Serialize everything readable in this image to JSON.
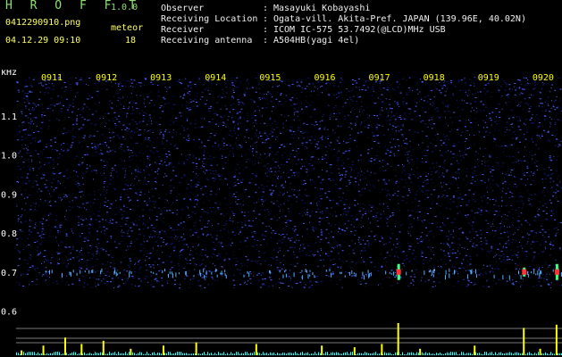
{
  "app": {
    "brand": "H R O F F T",
    "version": "1.0.0",
    "filename": "0412290910.png",
    "timestamp": "04.12.29 09:10",
    "meteor_label": "meteor",
    "meteor_count": "18"
  },
  "info": [
    {
      "label": "Observer",
      "value": "Masayuki Kobayashi"
    },
    {
      "label": "Receiving Location",
      "value": "Ogata-vill. Akita-Pref. JAPAN (139.96E, 40.02N)"
    },
    {
      "label": "Receiver",
      "value": "ICOM IC-575 53.7492(@LCD)MHz USB"
    },
    {
      "label": "Receiving antenna",
      "value": "A504HB(yagi 4el)"
    }
  ],
  "info_separator": ":",
  "colors": {
    "background": "#000000",
    "noise_dark": "#101870",
    "noise_bright": "#4c5cff",
    "time_label": "#ffff00",
    "axis_label": "#ffffff",
    "counter_bars": "#ffff00",
    "counter_noise": "#33ffff",
    "echo_red": "#ff3030",
    "echo_green": "#40ff80",
    "green_text": "#8fe070"
  },
  "chart_data": {
    "type": "heatmap",
    "title": "",
    "unit_label": "kHz",
    "time_ticks": [
      "0911",
      "0912",
      "0913",
      "0914",
      "0915",
      "0916",
      "0917",
      "0918",
      "0919",
      "0920"
    ],
    "freq_ticks": [
      1.1,
      1.0,
      0.9,
      0.8,
      0.7,
      0.6
    ],
    "freq_range_khz": [
      0.56,
      1.2
    ],
    "time_range_minutes": [
      0,
      10
    ],
    "meteor_echoes": [
      {
        "time_min": 7.0,
        "freq_khz": 0.7,
        "strength": "strong"
      },
      {
        "time_min": 9.3,
        "freq_khz": 0.7,
        "strength": "medium"
      },
      {
        "time_min": 9.9,
        "freq_khz": 0.7,
        "strength": "strong"
      }
    ],
    "meteor_count_bars": [
      {
        "time_min": 0.1,
        "height": 0.15
      },
      {
        "time_min": 0.5,
        "height": 0.3
      },
      {
        "time_min": 0.9,
        "height": 0.55
      },
      {
        "time_min": 1.2,
        "height": 0.35
      },
      {
        "time_min": 1.6,
        "height": 0.45
      },
      {
        "time_min": 2.1,
        "height": 0.2
      },
      {
        "time_min": 2.7,
        "height": 0.3
      },
      {
        "time_min": 3.3,
        "height": 0.4
      },
      {
        "time_min": 4.4,
        "height": 0.35
      },
      {
        "time_min": 5.6,
        "height": 0.3
      },
      {
        "time_min": 6.2,
        "height": 0.25
      },
      {
        "time_min": 6.7,
        "height": 0.35
      },
      {
        "time_min": 7.0,
        "height": 1.0
      },
      {
        "time_min": 7.4,
        "height": 0.2
      },
      {
        "time_min": 8.4,
        "height": 0.3
      },
      {
        "time_min": 9.3,
        "height": 0.85
      },
      {
        "time_min": 9.6,
        "height": 0.2
      },
      {
        "time_min": 9.9,
        "height": 0.95
      }
    ]
  }
}
